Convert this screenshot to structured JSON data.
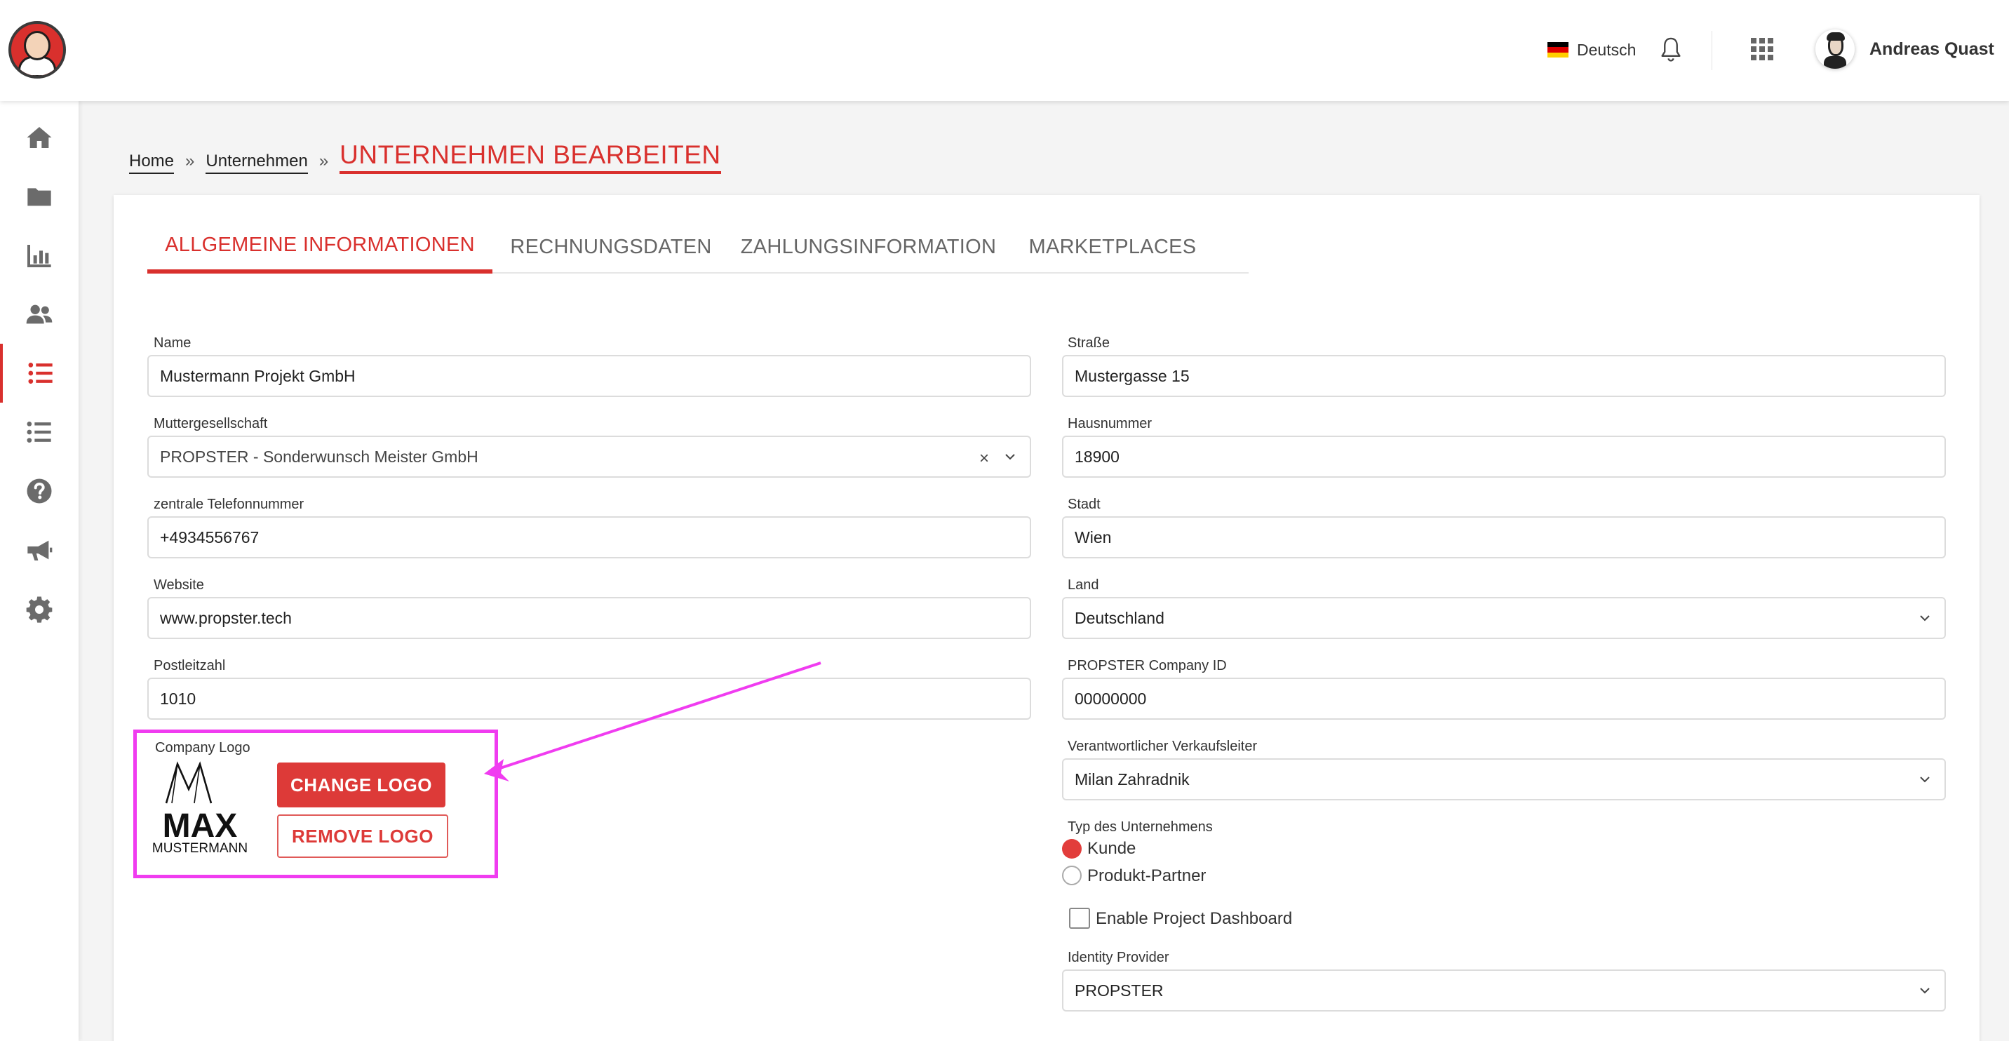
{
  "header": {
    "language": "Deutsch",
    "user_name": "Andreas Quast"
  },
  "sidebar": {
    "items": [
      "home-icon",
      "folder-icon",
      "chart-icon",
      "users-icon",
      "list-icon",
      "list-icon",
      "help-icon",
      "megaphone-icon",
      "gear-icon"
    ],
    "active_index": 4
  },
  "breadcrumb": {
    "home": "Home",
    "companies": "Unternehmen",
    "current": "UNTERNEHMEN BEARBEITEN",
    "separator": "»"
  },
  "tabs": [
    {
      "label": "ALLGEMEINE INFORMATIONEN",
      "active": true
    },
    {
      "label": "RECHNUNGSDATEN",
      "active": false
    },
    {
      "label": "ZAHLUNGSINFORMATION",
      "active": false
    },
    {
      "label": "MARKETPLACES",
      "active": false
    }
  ],
  "left_fields": {
    "name": {
      "label": "Name",
      "value": "Mustermann Projekt GmbH"
    },
    "parent": {
      "label": "Muttergesellschaft",
      "value": "PROPSTER - Sonderwunsch Meister GmbH"
    },
    "phone": {
      "label": "zentrale Telefonnummer",
      "value": "+4934556767"
    },
    "website": {
      "label": "Website",
      "value": "www.propster.tech"
    },
    "zip": {
      "label": "Postleitzahl",
      "value": "1010"
    }
  },
  "logo": {
    "label": "Company Logo",
    "logo_text_main": "MAX",
    "logo_text_sub": "MUSTERMANN",
    "change_label": "CHANGE LOGO",
    "remove_label": "REMOVE LOGO"
  },
  "right_fields": {
    "street": {
      "label": "Straße",
      "value": "Mustergasse 15"
    },
    "house_number": {
      "label": "Hausnummer",
      "value": "18900"
    },
    "city": {
      "label": "Stadt",
      "value": "Wien"
    },
    "country": {
      "label": "Land",
      "value": "Deutschland"
    },
    "company_id": {
      "label": "PROPSTER Company ID",
      "value": "00000000"
    },
    "sales_lead": {
      "label": "Verantwortlicher Verkaufsleiter",
      "value": "Milan Zahradnik"
    },
    "company_type": {
      "label": "Typ des Unternehmens",
      "options": [
        "Kunde",
        "Produkt-Partner"
      ],
      "selected": "Kunde"
    },
    "dashboard": {
      "label": "Enable Project Dashboard",
      "checked": false
    },
    "identity_provider": {
      "label": "Identity Provider",
      "value": "PROPSTER"
    }
  },
  "colors": {
    "accent": "#d9302d",
    "annotation": "#f03cf0"
  }
}
